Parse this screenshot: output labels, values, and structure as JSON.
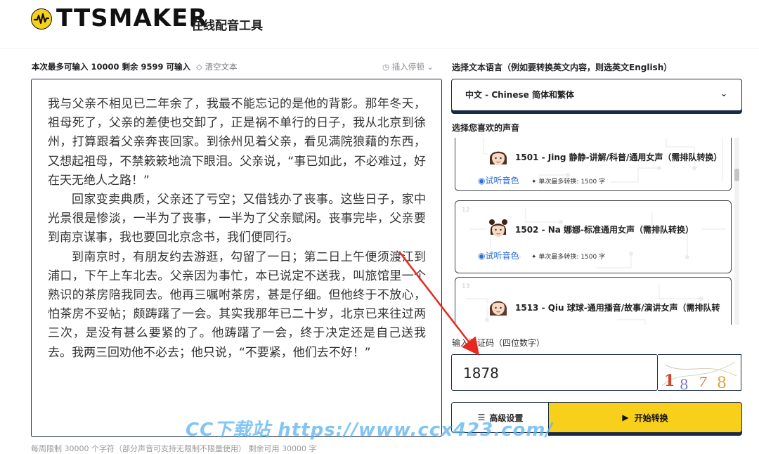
{
  "header": {
    "logo_text": "TTSMAKER",
    "logo_sub": "在线配音工具"
  },
  "editor": {
    "limit_text": "本次最多可输入 10000 剩余 9599 可输入",
    "clear_label": "清空文本",
    "pause_label": "插入停顿",
    "paragraphs": [
      "我与父亲不相见已二年余了，我最不能忘记的是他的背影。那年冬天，祖母死了，父亲的差使也交卸了，正是祸不单行的日子，我从北京到徐州，打算跟着父亲奔丧回家。到徐州见着父亲，看见满院狼藉的东西，又想起祖母，不禁簌簌地流下眼泪。父亲说，“事已如此，不必难过，好在天无绝人之路！”",
      "回家变卖典质，父亲还了亏空；又借钱办了丧事。这些日子，家中光景很是惨淡，一半为了丧事，一半为了父亲赋闲。丧事完毕，父亲要到南京谋事，我也要回北京念书，我们便同行。",
      "到南京时，有朋友约去游逛，勾留了一日；第二日上午便须渡江到浦口，下午上车北去。父亲因为事忙，本已说定不送我，叫旅馆里一个熟识的茶房陪我同去。他再三嘱咐茶房，甚是仔细。但他终于不放心，怕茶房不妥帖；颇踌躇了一会。其实我那年已二十岁，北京已来往过两三次，是没有甚么要紧的了。他踌躇了一会，终于决定还是自己送我去。我两三回劝他不必去；他只说，“不要紧，他们去不好！”"
    ],
    "footnote": "每周限制 30000 个字符（部分声音可支持无限制不限量使用）     剩余可用 30000 字"
  },
  "language": {
    "label": "选择文本语言（例如要转换英文内容，则选英文English）",
    "selected": "中文 - Chinese 简体和繁体"
  },
  "voices": {
    "label": "选择您喜欢的声音",
    "items": [
      {
        "num": "",
        "name": "1501 - Jing 静静-讲解/科普/通用女声（需排队转换）",
        "play": "试听音色",
        "limit": "单次最多转换: 1500 字"
      },
      {
        "num": "12",
        "name": "1502 - Na 娜娜-标准通用女声（需排队转换）",
        "play": "试听音色",
        "limit": "单次最多转换: 1500 字"
      },
      {
        "num": "13",
        "name": "1513 - Qiu 球球-通用播音/故事/演讲女声（需排队转",
        "play": "",
        "limit": ""
      }
    ]
  },
  "captcha": {
    "label": "输入验证码（四位数字）",
    "value": "1878",
    "image_digits": "1878"
  },
  "actions": {
    "advanced_label": "高级设置",
    "start_label": "开始转换"
  },
  "watermark": "CC下载站 https://www.ccx423.com/",
  "colors": {
    "accent_yellow": "#f8d01b",
    "border_navy": "#1a2a44",
    "link_blue": "#2a6ed9",
    "arrow_red": "#e8281e"
  }
}
